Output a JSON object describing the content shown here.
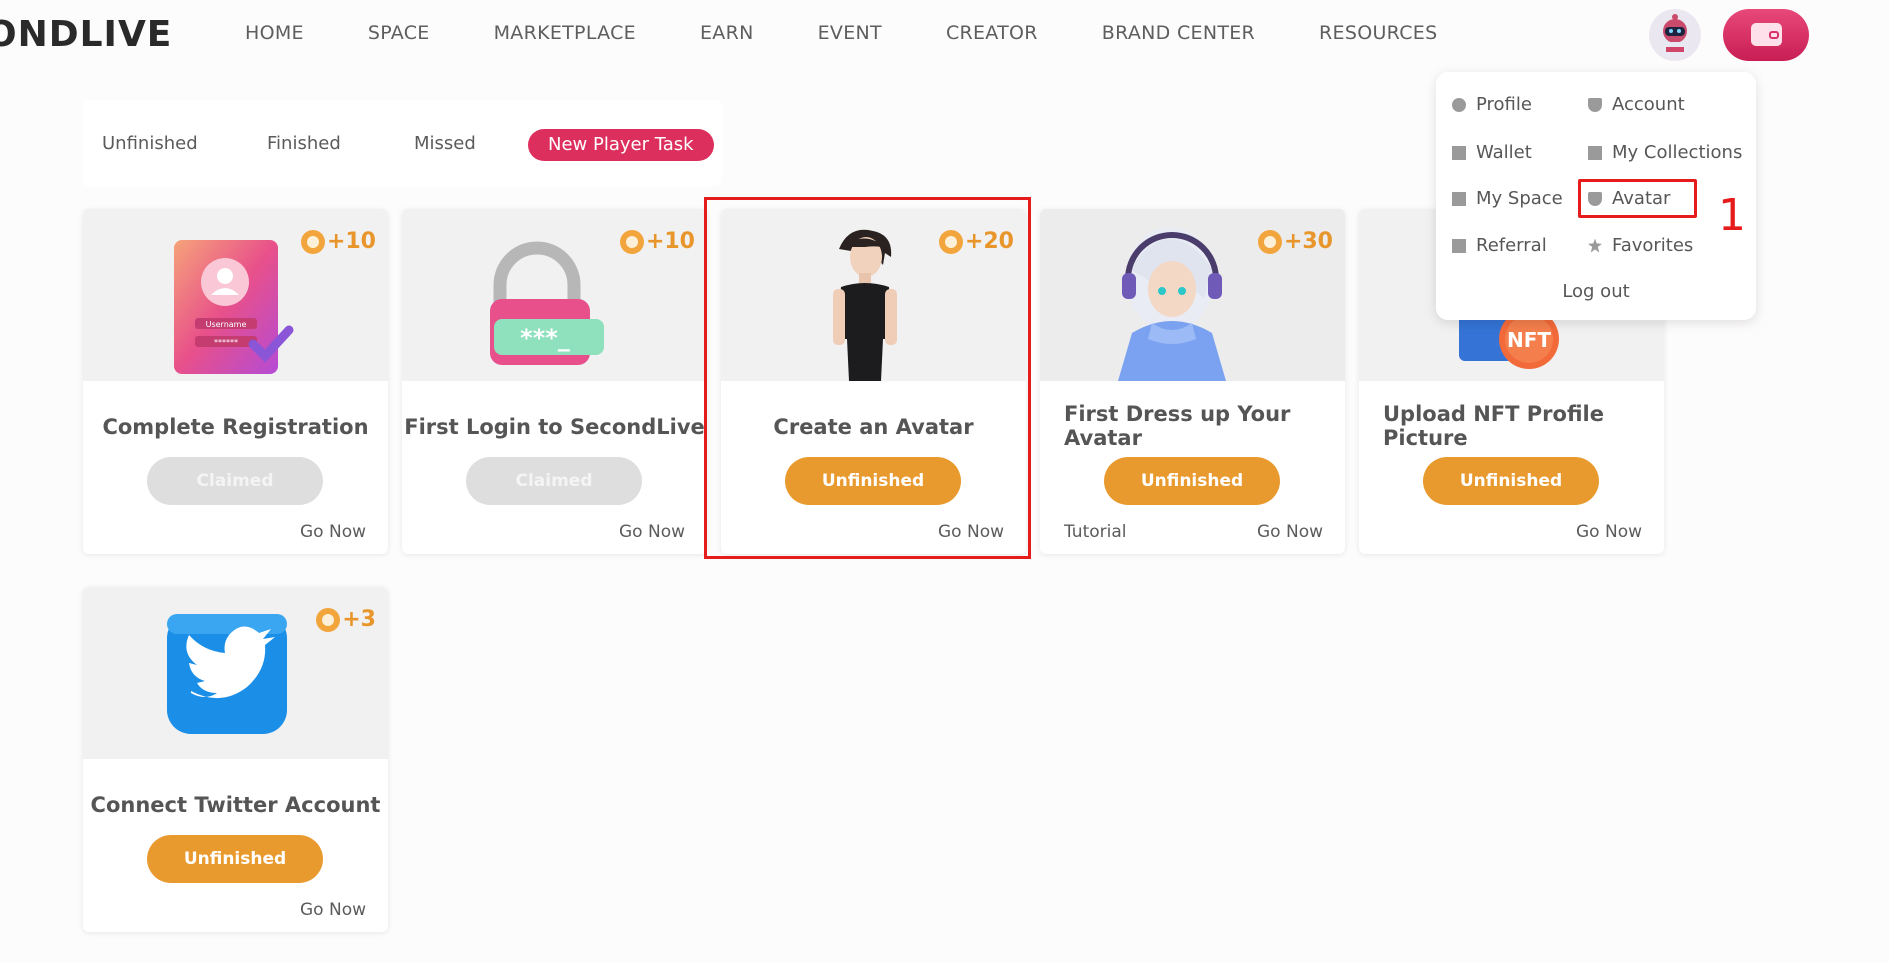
{
  "brand": {
    "logo": "ONDLIVE"
  },
  "nav": {
    "items": [
      "HOME",
      "SPACE",
      "MARKETPLACE",
      "EARN",
      "EVENT",
      "CREATOR",
      "BRAND CENTER",
      "RESOURCES"
    ]
  },
  "tabs": {
    "items": [
      "Unfinished",
      "Finished",
      "Missed",
      "New Player Task"
    ],
    "active": "New Player Task"
  },
  "cards": [
    {
      "title": "Complete Registration",
      "reward": "+10",
      "status": "Claimed",
      "go": "Go Now"
    },
    {
      "title": "First Login to SecondLive",
      "reward": "+10",
      "status": "Claimed",
      "go": "Go Now"
    },
    {
      "title": "Create an Avatar",
      "reward": "+20",
      "status": "Unfinished",
      "go": "Go Now"
    },
    {
      "title": "First Dress up Your Avatar",
      "reward": "+30",
      "status": "Unfinished",
      "go": "Go Now",
      "tutorial": "Tutorial"
    },
    {
      "title": "Upload NFT Profile Picture",
      "reward": "",
      "status": "Unfinished",
      "go": "Go Now"
    },
    {
      "title": "Connect Twitter Account",
      "reward": "+3",
      "status": "Unfinished",
      "go": "Go Now"
    }
  ],
  "image_text": {
    "username": "Username",
    "password": "******",
    "nft": "NFT",
    "lock": "***_"
  },
  "menu": {
    "profile": "Profile",
    "account": "Account",
    "wallet": "Wallet",
    "collections": "My Collections",
    "myspace": "My Space",
    "avatar": "Avatar",
    "referral": "Referral",
    "favorites": "Favorites",
    "logout": "Log out"
  },
  "annotation": {
    "step": "1"
  },
  "colors": {
    "accent": "#dd2f5d",
    "unfinished": "#e99a2e",
    "claimed": "#dedede",
    "highlight": "#e61c1c",
    "coin": "#f2a53c"
  }
}
